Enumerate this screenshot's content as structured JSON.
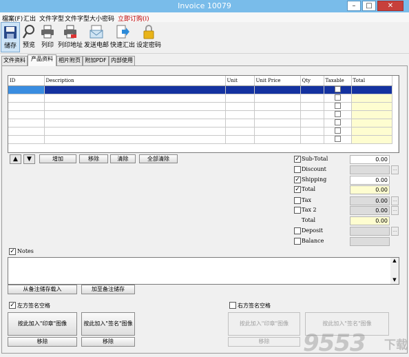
{
  "window": {
    "title": "Invoice 10079",
    "minimize_glyph": "–",
    "maximize_glyph": "□",
    "close_glyph": "✕"
  },
  "menu": [
    "檔案(F)",
    "汇出",
    "文件字型",
    "文件字型大小",
    "密码",
    "立即订购(I)"
  ],
  "menu_accent": "#c00000",
  "toolbar": [
    {
      "label": "储存",
      "icon": "floppy-save-icon"
    },
    {
      "label": "预览",
      "icon": "magnifier-preview-icon"
    },
    {
      "label": "列印",
      "icon": "printer-icon"
    },
    {
      "label": "列印地址",
      "icon": "printer-address-icon"
    },
    {
      "label": "发送电邮",
      "icon": "email-envelope-icon"
    },
    {
      "label": "快速汇出",
      "icon": "quick-export-icon"
    },
    {
      "label": "设定密码",
      "icon": "padlock-icon"
    }
  ],
  "tabs": [
    "文件资料",
    "产品资料",
    "相片附页",
    "附加PDF",
    "内部使用"
  ],
  "active_tab": 1,
  "grid": {
    "columns": [
      "ID",
      "Description",
      "Unit",
      "Unit Price",
      "Qty",
      "Taxable",
      "Total"
    ],
    "rows": 7
  },
  "grid_buttons": {
    "up": "▲",
    "down": "▼",
    "add": "增加",
    "remove": "移除",
    "clear": "清除",
    "clear_all": "全部清除"
  },
  "totals": {
    "subtotal": {
      "label": "Sub-Total",
      "value": "0.00",
      "checked": true
    },
    "discount": {
      "label": "Discount",
      "value": "",
      "checked": false
    },
    "shipping": {
      "label": "Shipping",
      "value": "0.00",
      "checked": true
    },
    "total1": {
      "label": "Total",
      "value": "0.00",
      "checked": true
    },
    "tax": {
      "label": "Tax",
      "value": "0.00",
      "checked": false
    },
    "tax2": {
      "label": "Tax 2",
      "value": "0.00",
      "checked": false
    },
    "total2": {
      "label": "Total",
      "value": "0.00"
    },
    "deposit": {
      "label": "Deposit",
      "value": "",
      "checked": false
    },
    "balance": {
      "label": "Balance",
      "value": "",
      "checked": false
    },
    "ellipsis": "..."
  },
  "notes": {
    "label": "Notes",
    "load_button": "从备注储存载入",
    "save_button": "加至备注储存"
  },
  "left_sig": {
    "label": "左方签名空格",
    "stamp_button": "按此加入\"印章\"图像",
    "sign_button": "按此加入\"签名\"图像",
    "remove1": "移除",
    "remove2": "移除"
  },
  "right_sig": {
    "label": "右方签名空格",
    "stamp_button": "按此加入\"印章\"图像",
    "sign_button": "按此加入\"签名\"图像",
    "remove1": "移除"
  },
  "watermark": {
    "number": "9553",
    "text": "下载"
  },
  "colors": {
    "titlebar": "#79bcea",
    "selected_row": "#1432a0",
    "total_fill": "#fefdd0"
  }
}
